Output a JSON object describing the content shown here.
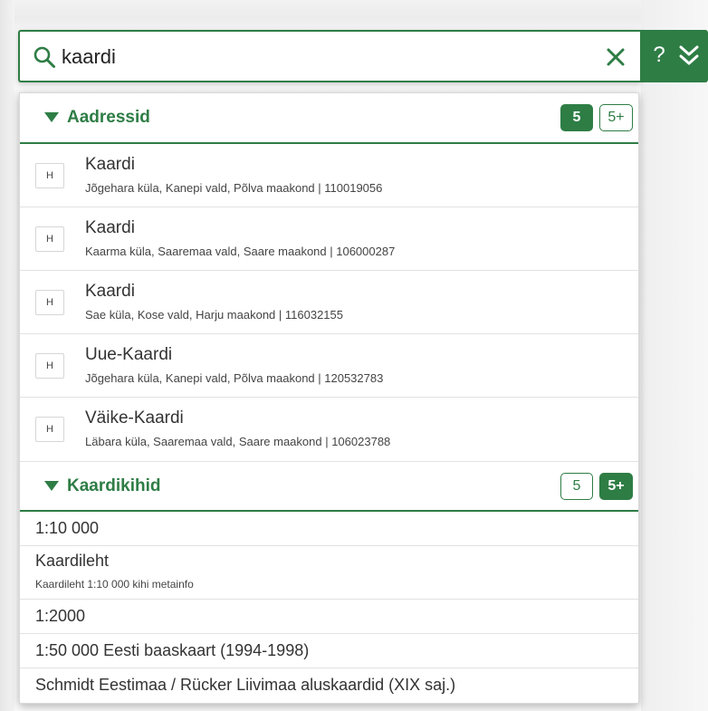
{
  "search": {
    "value": "kaardi",
    "help_label": "?"
  },
  "colors": {
    "accent": "#2e7d45"
  },
  "icons": {
    "search": "search-icon",
    "clear": "close-icon",
    "expand": "double-chevron-down-icon",
    "section_toggle": "triangle-down-icon"
  },
  "addresses": {
    "title": "Aadressid",
    "badge_count": "5",
    "badge_more": "5+",
    "items": [
      {
        "type": "H",
        "name": "Kaardi",
        "detail": "Jõgehara küla, Kanepi vald, Põlva maakond | 110019056"
      },
      {
        "type": "H",
        "name": "Kaardi",
        "detail": "Kaarma küla, Saaremaa vald, Saare maakond | 106000287"
      },
      {
        "type": "H",
        "name": "Kaardi",
        "detail": "Sae küla, Kose vald, Harju maakond | 116032155"
      },
      {
        "type": "H",
        "name": "Uue-Kaardi",
        "detail": "Jõgehara küla, Kanepi vald, Põlva maakond | 120532783"
      },
      {
        "type": "H",
        "name": "Väike-Kaardi",
        "detail": "Läbara küla, Saaremaa vald, Saare maakond | 106023788"
      }
    ]
  },
  "layers": {
    "title": "Kaardikihid",
    "badge_count": "5",
    "badge_more": "5+",
    "items": [
      {
        "name": "1:10 000",
        "sub": ""
      },
      {
        "name": "Kaardileht",
        "sub": "Kaardileht 1:10 000 kihi metainfo"
      },
      {
        "name": "1:2000",
        "sub": ""
      },
      {
        "name": "1:50 000 Eesti baaskaart (1994-1998)",
        "sub": ""
      },
      {
        "name": "Schmidt Eestimaa / Rücker Liivimaa aluskaardid (XIX saj.)",
        "sub": ""
      }
    ]
  }
}
